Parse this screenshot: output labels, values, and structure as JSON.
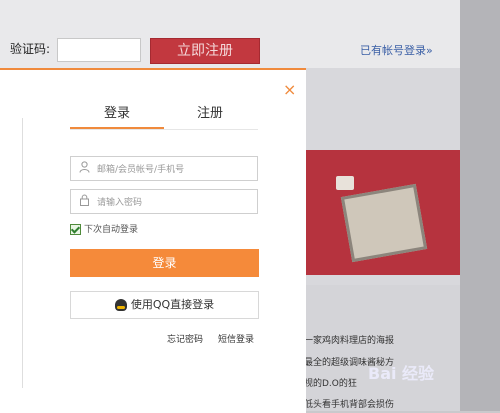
{
  "top": {
    "captcha_label": "验证码:",
    "register_button": "立即注册",
    "have_account_link": "已有帐号登录»"
  },
  "modal": {
    "close_icon": "×",
    "tabs": [
      "登录",
      "注册"
    ],
    "account_placeholder": "邮箱/会员帐号/手机号",
    "password_placeholder": "请输入密码",
    "remember_label": "下次自动登录",
    "login_button": "登录",
    "qq_button": "使用QQ直接登录",
    "forgot_password": "忘记密码",
    "sms_login": "短信登录"
  },
  "side_news": [
    "岛国一家鸡肉料理店的海报",
    "史上最全的超级调味酱秘方",
    "上电视的D.O的狂",
    "长期低头看手机背部会损伤"
  ],
  "watermark": "Bai 经验",
  "colors": {
    "accent": "#f08a3c",
    "register_bg": "#c2383f",
    "link": "#3a5fa6"
  }
}
